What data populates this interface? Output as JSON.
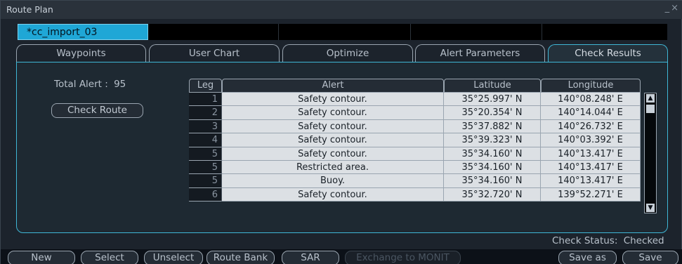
{
  "window": {
    "title": "Route Plan",
    "controls": "_×"
  },
  "route_strip": {
    "active_route": "*cc_import_03"
  },
  "tabs": [
    {
      "label": "Waypoints"
    },
    {
      "label": "User Chart"
    },
    {
      "label": "Optimize"
    },
    {
      "label": "Alert Parameters"
    },
    {
      "label": "Check Results",
      "active": true
    }
  ],
  "check_results": {
    "total_alert_label": "Total Alert :",
    "total_alert_value": "95",
    "check_route_label": "Check Route",
    "columns": {
      "leg": "Leg",
      "alert": "Alert",
      "latitude": "Latitude",
      "longitude": "Longitude"
    },
    "rows": [
      {
        "leg": "1",
        "alert": "Safety contour.",
        "latitude": "35°25.997' N",
        "longitude": "140°08.248' E"
      },
      {
        "leg": "2",
        "alert": "Safety contour.",
        "latitude": "35°20.354' N",
        "longitude": "140°14.044' E"
      },
      {
        "leg": "3",
        "alert": "Safety contour.",
        "latitude": "35°37.882' N",
        "longitude": "140°26.732' E"
      },
      {
        "leg": "4",
        "alert": "Safety contour.",
        "latitude": "35°39.323' N",
        "longitude": "140°03.392' E"
      },
      {
        "leg": "5",
        "alert": "Safety contour.",
        "latitude": "35°34.160' N",
        "longitude": "140°13.417' E"
      },
      {
        "leg": "5",
        "alert": "Restricted area.",
        "latitude": "35°34.160' N",
        "longitude": "140°13.417' E"
      },
      {
        "leg": "5",
        "alert": "Buoy.",
        "latitude": "35°34.160' N",
        "longitude": "140°13.417' E"
      },
      {
        "leg": "6",
        "alert": "Safety contour.",
        "latitude": "35°32.720' N",
        "longitude": "139°52.271' E"
      }
    ],
    "status_label": "Check Status:",
    "status_value": "Checked"
  },
  "bottom_buttons": {
    "new": "New",
    "select": "Select",
    "unselect": "Unselect",
    "route_bank": "Route Bank",
    "sar": "SAR",
    "exchange": "Exchange to MONIT",
    "save_as": "Save as",
    "save": "Save"
  },
  "colors": {
    "accent": "#1fa7d6",
    "frame": "#3fb7d6",
    "background": "#1c232c"
  }
}
